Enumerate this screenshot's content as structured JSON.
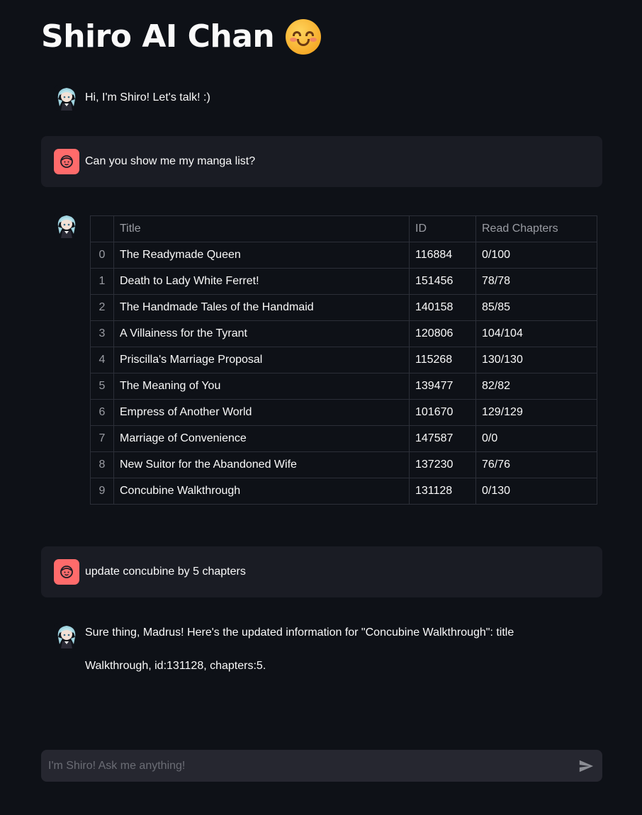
{
  "app": {
    "title": "Shiro AI Chan",
    "title_emoji_icon": "smiling-face-icon"
  },
  "messages": [
    {
      "role": "assistant",
      "avatar_icon": "shiro-avatar-icon",
      "text": "Hi, I'm Shiro! Let's talk! :)"
    },
    {
      "role": "user",
      "avatar_icon": "user-face-icon",
      "text": "Can you show me my manga list?"
    },
    {
      "role": "assistant",
      "avatar_icon": "shiro-avatar-icon",
      "type": "table"
    },
    {
      "role": "user",
      "avatar_icon": "user-face-icon",
      "text": "update concubine by 5 chapters"
    },
    {
      "role": "assistant",
      "avatar_icon": "shiro-avatar-icon",
      "text_line1": "Sure thing, Madrus! Here's the updated information for \"Concubine Walkthrough\": title",
      "text_line2": "Walkthrough, id:131128, chapters:5."
    }
  ],
  "manga_table": {
    "columns": [
      "",
      "Title",
      "ID",
      "Read Chapters"
    ],
    "rows": [
      {
        "index": "0",
        "title": "The Readymade Queen",
        "id": "116884",
        "read": "0/100"
      },
      {
        "index": "1",
        "title": "Death to Lady White Ferret!",
        "id": "151456",
        "read": "78/78"
      },
      {
        "index": "2",
        "title": "The Handmade Tales of the Handmaid",
        "id": "140158",
        "read": "85/85"
      },
      {
        "index": "3",
        "title": "A Villainess for the Tyrant",
        "id": "120806",
        "read": "104/104"
      },
      {
        "index": "4",
        "title": "Priscilla's Marriage Proposal",
        "id": "115268",
        "read": "130/130"
      },
      {
        "index": "5",
        "title": "The Meaning of You",
        "id": "139477",
        "read": "82/82"
      },
      {
        "index": "6",
        "title": "Empress of Another World",
        "id": "101670",
        "read": "129/129"
      },
      {
        "index": "7",
        "title": "Marriage of Convenience",
        "id": "147587",
        "read": "0/0"
      },
      {
        "index": "8",
        "title": "New Suitor for the Abandoned Wife",
        "id": "137230",
        "read": "76/76"
      },
      {
        "index": "9",
        "title": "Concubine Walkthrough",
        "id": "131128",
        "read": "0/130"
      }
    ]
  },
  "chat_input": {
    "placeholder": "I'm Shiro! Ask me anything!",
    "value": "",
    "send_icon": "send-icon"
  },
  "colors": {
    "background": "#0e1117",
    "user_bubble": "#1a1c24",
    "user_avatar": "#ff6b6b",
    "input_bg": "#262730"
  }
}
